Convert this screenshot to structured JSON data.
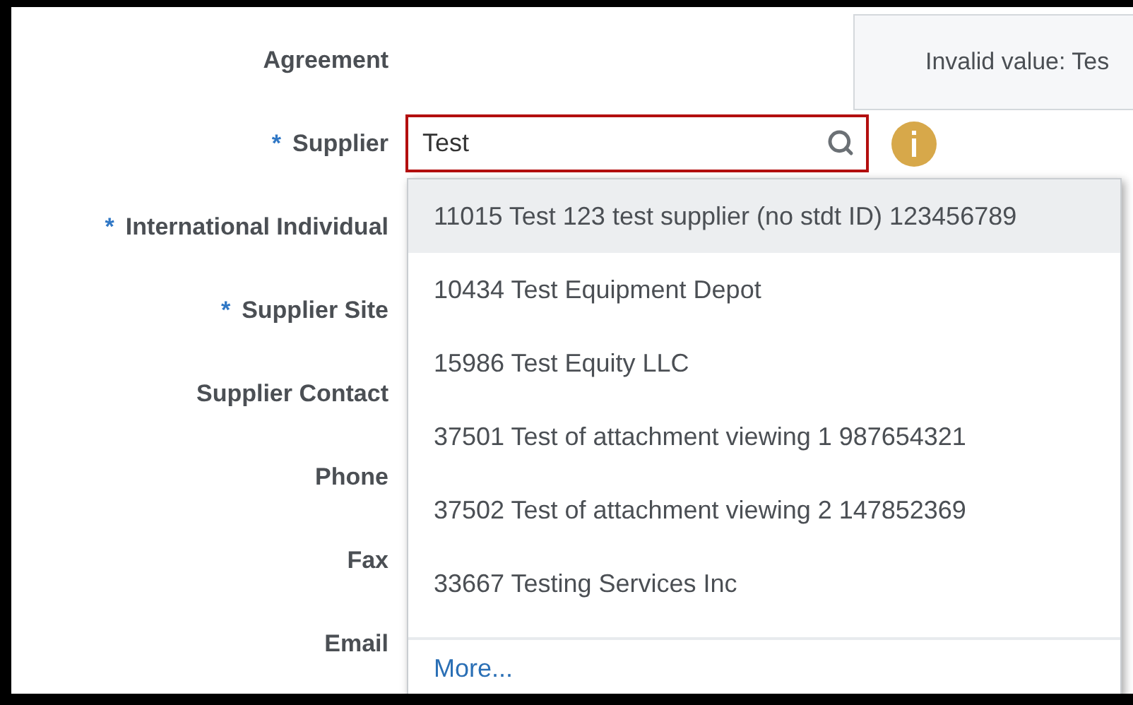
{
  "required_marker": "*",
  "fields": [
    {
      "label": "Agreement",
      "required": false
    },
    {
      "label": "Supplier",
      "required": true,
      "kind": "lookup",
      "value": "Test",
      "error": true
    },
    {
      "label": "International Individual",
      "required": true
    },
    {
      "label": "Supplier Site",
      "required": true
    },
    {
      "label": "Supplier Contact",
      "required": false
    },
    {
      "label": "Phone",
      "required": false
    },
    {
      "label": "Fax",
      "required": false
    },
    {
      "label": "Email",
      "required": false
    }
  ],
  "tooltip": {
    "message": "Invalid value: Tes"
  },
  "suggestions": [
    {
      "label": "11015 Test 123 test supplier (no stdt ID) 123456789",
      "selected": true
    },
    {
      "label": "10434 Test Equipment Depot",
      "selected": false
    },
    {
      "label": "15986 Test Equity LLC",
      "selected": false
    },
    {
      "label": "37501 Test of attachment viewing 1 987654321",
      "selected": false
    },
    {
      "label": "37502 Test of attachment viewing 2 147852369",
      "selected": false
    },
    {
      "label": "33667 Testing Services Inc",
      "selected": false
    }
  ],
  "more_link": "More..."
}
